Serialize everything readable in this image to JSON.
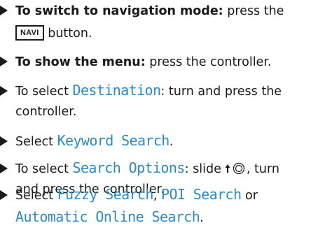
{
  "steps": [
    {
      "lines": [
        {
          "bold": "To switch to navigation mode:",
          "text": " press the"
        },
        {
          "key": "NAVI",
          "text": " button."
        }
      ]
    },
    {
      "lines": [
        {
          "bold": "To show the menu:",
          "text": " press the controller."
        }
      ]
    },
    {
      "lines": [
        {
          "pre": "To select ",
          "term": "Destination",
          "text": ": turn and press the"
        },
        {
          "text": "controller."
        }
      ]
    },
    {
      "lines": [
        {
          "pre": "Select ",
          "term": "Keyword Search",
          "post": "."
        }
      ]
    },
    {
      "lines": [
        {
          "pre": "To select ",
          "term": "Search Options",
          "text": ": slide",
          "after": ", turn"
        },
        {
          "text": "and press the controller."
        }
      ]
    },
    {
      "lines": [
        {
          "pre": "Select ",
          "term1": "Fuzzy Search",
          "sep": ", ",
          "term2": "POI Search",
          "post": " or"
        },
        {
          "term": "Automatic Online Search",
          "post": "."
        }
      ]
    }
  ],
  "icons": {
    "bullet": "triangle-bullet-icon",
    "controller": "controller-slide-up-icon"
  },
  "colors": {
    "term": "#2b8bc2",
    "text": "#1a1a1a"
  }
}
